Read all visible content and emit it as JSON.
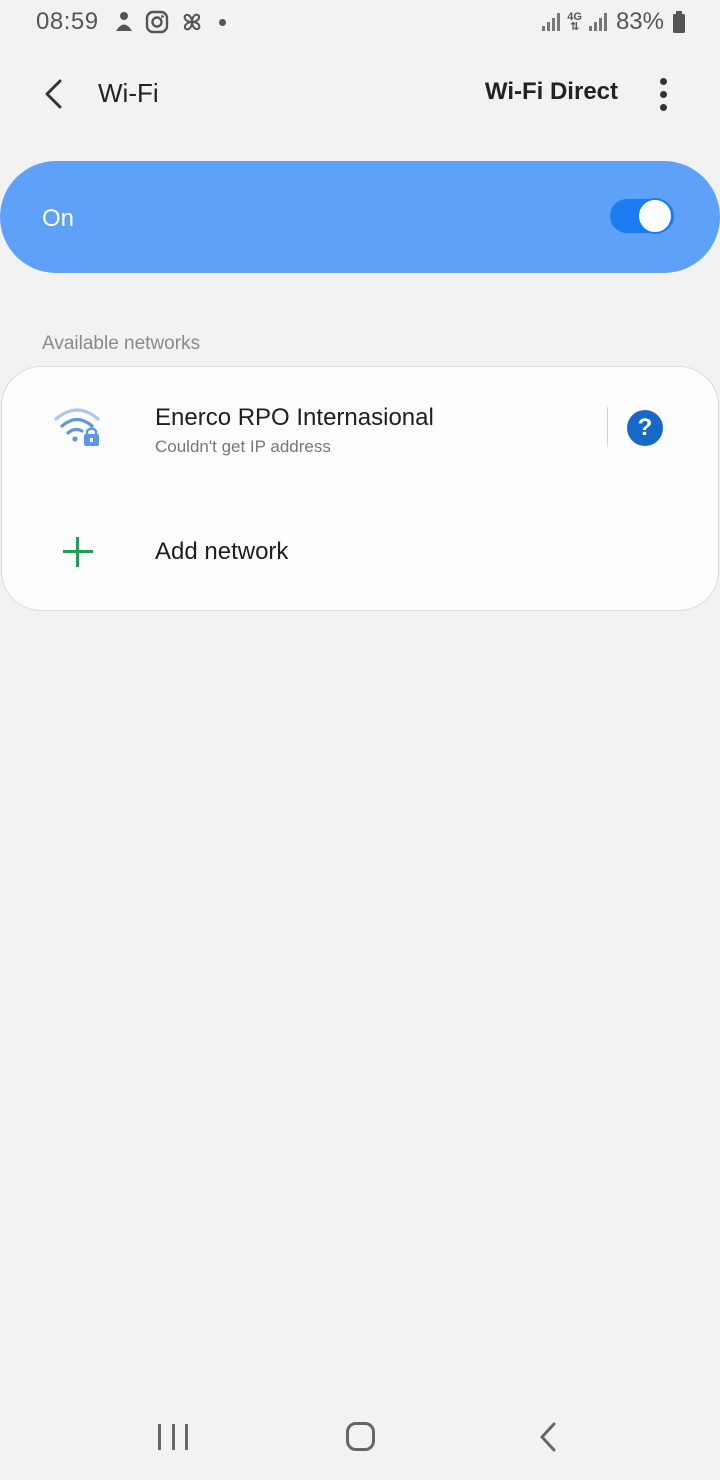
{
  "status_bar": {
    "time": "08:59",
    "network_type": "4G",
    "battery": "83%"
  },
  "header": {
    "title": "Wi-Fi",
    "wifi_direct_label": "Wi-Fi Direct"
  },
  "wifi_toggle": {
    "label": "On",
    "state": "on",
    "accent_color": "#5ea1f8"
  },
  "available_networks": {
    "section_label": "Available networks",
    "networks": [
      {
        "name": "Enerco RPO Internasional",
        "status": "Couldn't get IP address",
        "icon": "wifi-locked-icon"
      }
    ],
    "add_network_label": "Add network"
  }
}
